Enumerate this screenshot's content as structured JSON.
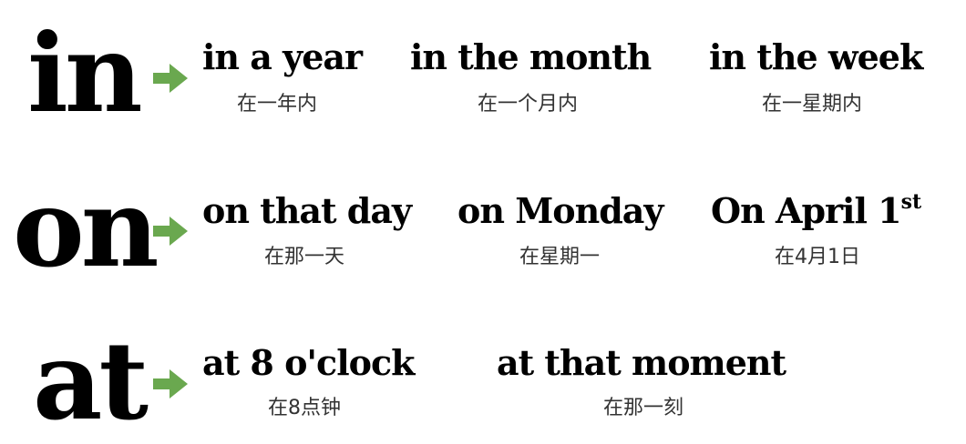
{
  "accent_color": "#6aa84f",
  "icons": [
    "arrow-right-icon"
  ],
  "rows": [
    {
      "preposition": "in",
      "phrases": [
        {
          "en": "in a year",
          "zh": "在一年内"
        },
        {
          "en": "in the month",
          "zh": "在一个月内"
        },
        {
          "en": "in the week",
          "zh": "在一星期内"
        }
      ]
    },
    {
      "preposition": "on",
      "phrases": [
        {
          "en": "on that day",
          "zh": "在那一天"
        },
        {
          "en": "on Monday",
          "zh": "在星期一"
        },
        {
          "en": "On April 1",
          "sup": "st",
          "zh": "在4月1日"
        }
      ]
    },
    {
      "preposition": "at",
      "phrases": [
        {
          "en": "at 8 o'clock",
          "zh": "在8点钟"
        },
        {
          "en": "at that moment",
          "zh": "在那一刻"
        }
      ]
    }
  ]
}
